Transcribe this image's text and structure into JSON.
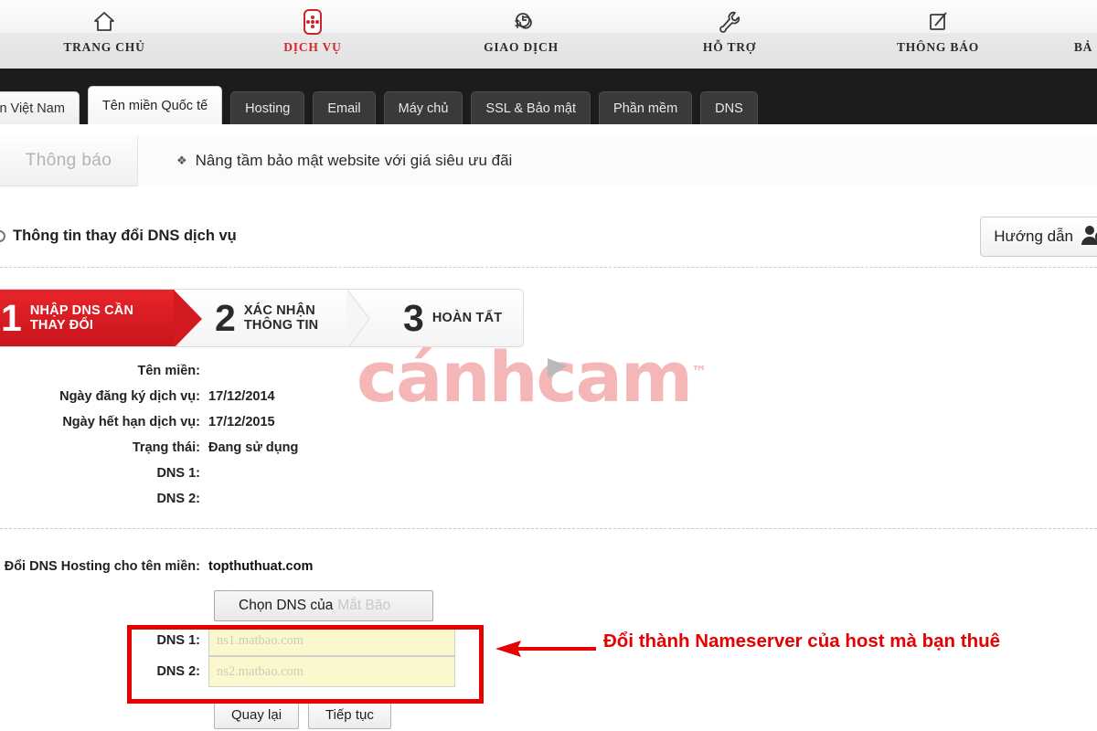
{
  "topnav": {
    "items": [
      {
        "label": "TRANG CHỦ",
        "icon": "home-icon",
        "active": false
      },
      {
        "label": "DỊCH VỤ",
        "icon": "services-grid-icon",
        "active": true
      },
      {
        "label": "GIAO DỊCH",
        "icon": "money-clock-icon",
        "active": false
      },
      {
        "label": "HỖ TRỢ",
        "icon": "wrench-icon",
        "active": false
      },
      {
        "label": "THÔNG BÁO",
        "icon": "edit-square-icon",
        "active": false
      },
      {
        "label": "BẢ",
        "icon": "none",
        "active": false
      }
    ]
  },
  "tabs": [
    {
      "label": "n miền Việt Nam",
      "state": "light"
    },
    {
      "label": "Tên miền Quốc tế",
      "state": "active"
    },
    {
      "label": "Hosting",
      "state": "dark"
    },
    {
      "label": "Email",
      "state": "dark"
    },
    {
      "label": "Máy chủ",
      "state": "dark"
    },
    {
      "label": "SSL & Bảo mật",
      "state": "dark"
    },
    {
      "label": "Phần mềm",
      "state": "dark"
    },
    {
      "label": "DNS",
      "state": "dark"
    }
  ],
  "announcement": {
    "label": "Thông báo",
    "bullet": "❖",
    "text": "Nâng tầm bảo mật website với giá siêu ưu đãi"
  },
  "page_header": {
    "title": "Thông tin thay đổi DNS dịch vụ",
    "guide_button": "Hướng dẫn"
  },
  "wizard": {
    "steps": [
      {
        "num": "1",
        "line1": "NHẬP DNS CẦN",
        "line2": "THAY ĐỔI",
        "active": true
      },
      {
        "num": "2",
        "line1": "XÁC NHẬN",
        "line2": "THÔNG TIN",
        "active": false
      },
      {
        "num": "3",
        "line1": "HOÀN TẤT",
        "line2": "",
        "active": false
      }
    ]
  },
  "info": {
    "rows": [
      {
        "label": "Tên miền:",
        "value": ""
      },
      {
        "label": "Ngày đăng ký dịch vụ:",
        "value": "17/12/2014"
      },
      {
        "label": "Ngày hết hạn dịch vụ:",
        "value": "17/12/2015"
      },
      {
        "label": "Trạng thái:",
        "value": "Đang sử dụng"
      },
      {
        "label": "DNS 1:",
        "value": ""
      },
      {
        "label": "DNS 2:",
        "value": ""
      }
    ]
  },
  "form": {
    "domain_label": "Đổi DNS Hosting cho tên miền:",
    "domain_value": "topthuthuat.com",
    "select_label": "Chọn DNS của",
    "select_muted": "Mắt Bão",
    "dns1_label": "DNS 1:",
    "dns1_value": "",
    "dns1_placeholder": "ns1.matbao.com",
    "dns2_label": "DNS 2:",
    "dns2_value": "",
    "dns2_placeholder": "ns2.matbao.com",
    "back_button": "Quay lại",
    "next_button": "Tiếp tục"
  },
  "annotation": {
    "text": "Đổi thành Nameserver của host mà bạn thuê",
    "color": "#e60000"
  },
  "watermark": {
    "part1": "cánh",
    "part2": "c",
    "part3": "am",
    "tm": "™",
    "color": "#f4b6b6"
  },
  "colors": {
    "brand_red": "#d2282e",
    "step_active": "#d41a21",
    "annotation_red": "#e60000",
    "input_yellow": "#fcf8cd",
    "tabbar_dark": "#1c1c1c"
  }
}
